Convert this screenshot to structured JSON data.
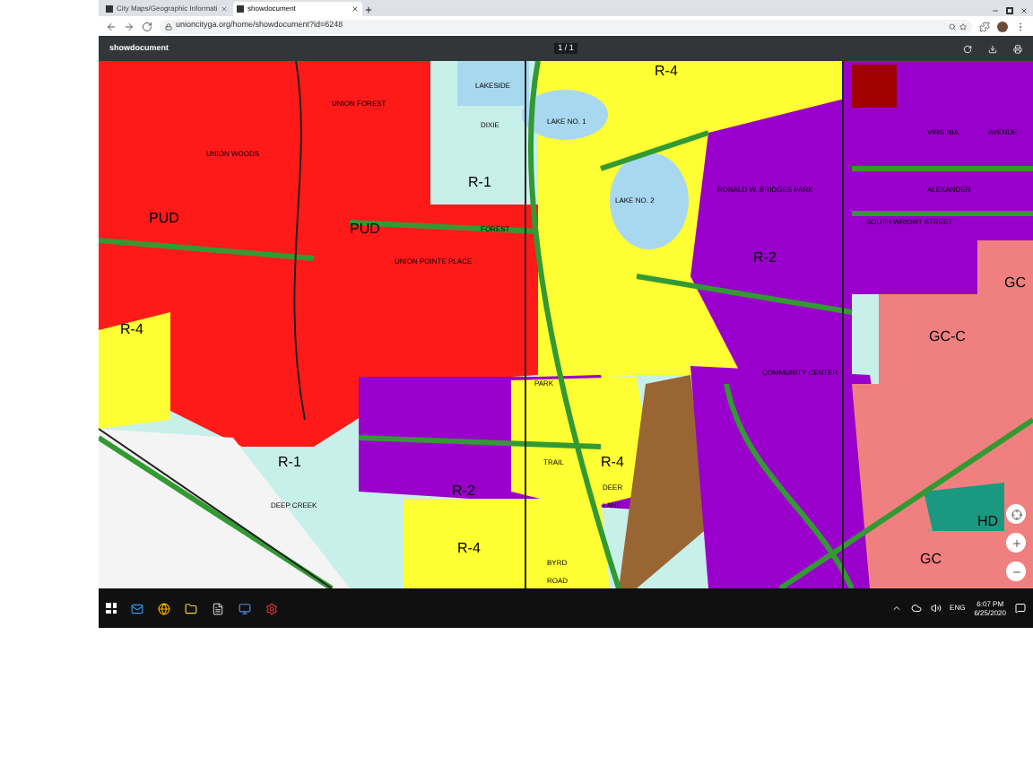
{
  "browser": {
    "tabs": [
      {
        "title": "City Maps/Geographic Informati",
        "selected": false
      },
      {
        "title": "showdocument",
        "selected": true
      }
    ],
    "url": "unioncityga.org/home/showdocument?id=6248"
  },
  "viewer": {
    "title": "showdocument",
    "page": "1 / 1"
  },
  "map": {
    "labels": [
      {
        "text": "R-4",
        "kind": "zone"
      },
      {
        "text": "LAKESIDE",
        "kind": "street"
      },
      {
        "text": "DIXIE",
        "kind": "street"
      },
      {
        "text": "LAKE NO. 1",
        "kind": "street"
      },
      {
        "text": "R-1",
        "kind": "zone"
      },
      {
        "text": "PUD",
        "kind": "zone"
      },
      {
        "text": "PUD",
        "kind": "zone"
      },
      {
        "text": "R-4",
        "kind": "zone"
      },
      {
        "text": "UNION FOREST",
        "kind": "street"
      },
      {
        "text": "UNION WOODS",
        "kind": "street"
      },
      {
        "text": "UNION POINTE PLACE",
        "kind": "street"
      },
      {
        "text": "FOREST",
        "kind": "street"
      },
      {
        "text": "LAKE NO. 2",
        "kind": "street"
      },
      {
        "text": "RONALD W. BRIDGES PARK",
        "kind": "street"
      },
      {
        "text": "R-2",
        "kind": "zone"
      },
      {
        "text": "VIRGINIA",
        "kind": "street"
      },
      {
        "text": "AVENUE",
        "kind": "street"
      },
      {
        "text": "ALEXANDER",
        "kind": "street"
      },
      {
        "text": "SOUTH WRIGHT STREET",
        "kind": "street"
      },
      {
        "text": "GC",
        "kind": "zone"
      },
      {
        "text": "GC-C",
        "kind": "zone"
      },
      {
        "text": "COMMUNITY CENTER",
        "kind": "street"
      },
      {
        "text": "R-1",
        "kind": "zone"
      },
      {
        "text": "DEEP CREEK",
        "kind": "street"
      },
      {
        "text": "R-2",
        "kind": "zone"
      },
      {
        "text": "R-4",
        "kind": "zone"
      },
      {
        "text": "DEER",
        "kind": "street"
      },
      {
        "text": "LANE",
        "kind": "street"
      },
      {
        "text": "TRAIL",
        "kind": "street"
      },
      {
        "text": "PARK",
        "kind": "street"
      },
      {
        "text": "BYRD",
        "kind": "street"
      },
      {
        "text": "ROAD",
        "kind": "street"
      },
      {
        "text": "R-4",
        "kind": "zone"
      },
      {
        "text": "HD",
        "kind": "zone"
      },
      {
        "text": "GC",
        "kind": "zone"
      }
    ]
  },
  "taskbar": {
    "language": "ENG",
    "time": "6:07 PM",
    "date": "6/25/2020"
  }
}
